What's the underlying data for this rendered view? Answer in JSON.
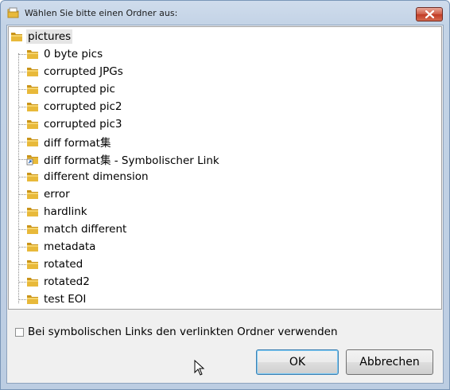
{
  "window": {
    "title": "Wählen Sie bitte einen Ordner aus:",
    "title_icon": "folder-new-icon",
    "close_icon": "close-icon"
  },
  "tree": {
    "root": {
      "label": "pictures",
      "icon": "folder-icon",
      "selected": true
    },
    "items": [
      {
        "label": "0 byte pics",
        "icon": "folder-icon"
      },
      {
        "label": "corrupted JPGs",
        "icon": "folder-icon"
      },
      {
        "label": "corrupted pic",
        "icon": "folder-icon"
      },
      {
        "label": "corrupted pic2",
        "icon": "folder-icon"
      },
      {
        "label": "corrupted pic3",
        "icon": "folder-icon"
      },
      {
        "label": "diff format集",
        "icon": "folder-icon"
      },
      {
        "label": "diff format集 - Symbolischer Link",
        "icon": "folder-shortcut-icon"
      },
      {
        "label": "different dimension",
        "icon": "folder-icon"
      },
      {
        "label": "error",
        "icon": "folder-icon"
      },
      {
        "label": "hardlink",
        "icon": "folder-icon"
      },
      {
        "label": "match different",
        "icon": "folder-icon"
      },
      {
        "label": "metadata",
        "icon": "folder-icon"
      },
      {
        "label": "rotated",
        "icon": "folder-icon"
      },
      {
        "label": "rotated2",
        "icon": "folder-icon"
      },
      {
        "label": "test EOI",
        "icon": "folder-icon"
      }
    ]
  },
  "options": {
    "use_linked_folder_label": "Bei symbolischen Links den verlinkten Ordner verwenden",
    "use_linked_folder_checked": false
  },
  "buttons": {
    "ok_label": "OK",
    "cancel_label": "Abbrechen"
  },
  "colors": {
    "folder_body": "#e8b93a",
    "folder_dark": "#c99419",
    "title_bar": "#c3d3e6",
    "close_red": "#c13b25"
  }
}
